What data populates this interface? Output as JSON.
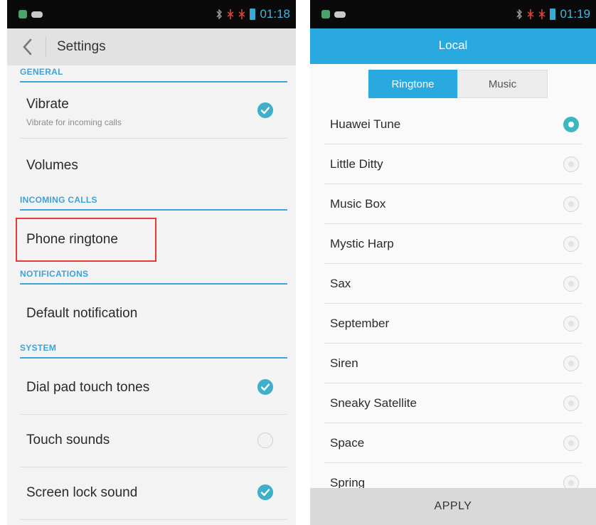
{
  "left": {
    "status_time": "01:18",
    "title": "Settings",
    "sections": {
      "general": "GENERAL",
      "incoming_calls": "INCOMING CALLS",
      "notifications": "NOTIFICATIONS",
      "system": "SYSTEM"
    },
    "items": {
      "vibrate": {
        "title": "Vibrate",
        "subtitle": "Vibrate for incoming calls",
        "checked": true
      },
      "volumes": {
        "title": "Volumes"
      },
      "phone_ringtone": {
        "title": "Phone ringtone"
      },
      "default_notification": {
        "title": "Default notification"
      },
      "dial_pad": {
        "title": "Dial pad touch tones",
        "checked": true
      },
      "touch_sounds": {
        "title": "Touch sounds",
        "checked": false
      },
      "screen_lock": {
        "title": "Screen lock sound",
        "checked": true
      }
    }
  },
  "right": {
    "status_time": "01:19",
    "title": "Local",
    "tabs": [
      "Ringtone",
      "Music"
    ],
    "active_tab": "Ringtone",
    "ringtones": [
      "Huawei Tune",
      "Little Ditty",
      "Music Box",
      "Mystic Harp",
      "Sax",
      "September",
      "Siren",
      "Sneaky Satellite",
      "Space",
      "Spring"
    ],
    "selected_ringtone": "Huawei Tune",
    "apply_label": "APPLY"
  },
  "colors": {
    "accent": "#29a9e0",
    "check": "#3fb0c8",
    "highlight": "#e53a36"
  }
}
